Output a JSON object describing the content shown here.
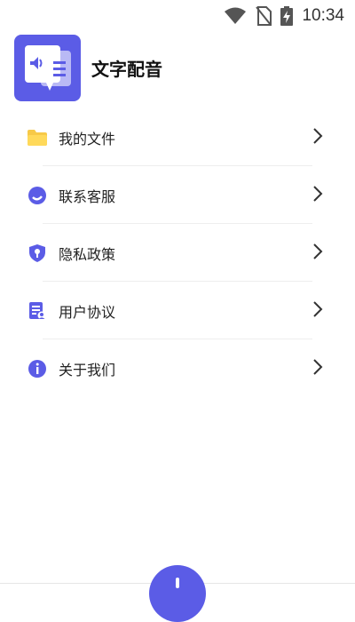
{
  "status_bar": {
    "time": "10:34"
  },
  "app": {
    "name": "文字配音"
  },
  "menu": [
    {
      "label": "我的文件",
      "icon": "folder-icon"
    },
    {
      "label": "联系客服",
      "icon": "customer-service-icon"
    },
    {
      "label": "隐私政策",
      "icon": "shield-lock-icon"
    },
    {
      "label": "用户协议",
      "icon": "user-agreement-icon"
    },
    {
      "label": "关于我们",
      "icon": "info-icon"
    }
  ],
  "colors": {
    "accent": "#5b5ce6",
    "folder": "#f7c948",
    "divider": "#eeeeee"
  }
}
